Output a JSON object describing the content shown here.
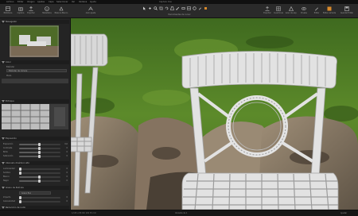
{
  "app": {
    "title": "Capture One",
    "menu": [
      "Archivo",
      "Editar",
      "Imagen",
      "Ajustes",
      "Capa",
      "Seleccionar",
      "Ver",
      "Ventana",
      "Ayuda"
    ]
  },
  "toolbar": {
    "left_buttons": [
      {
        "label": "Biblioteca",
        "icon": "library-icon"
      },
      {
        "label": "Captura",
        "icon": "capture-icon"
      },
      {
        "label": "Exportar",
        "icon": "export-icon"
      },
      {
        "label": "Metadatos",
        "icon": "metadata-icon"
      },
      {
        "label": "Balance Blanco",
        "icon": "white-balance-icon"
      },
      {
        "label": "Auto ajuste",
        "icon": "auto-adjust-icon"
      }
    ],
    "cursor_tools_label": "Herramientas de cursor",
    "right_buttons": [
      {
        "label": "Exportar",
        "icon": "export-icon"
      },
      {
        "label": "Cuadrícula",
        "icon": "grid-icon"
      },
      {
        "label": "Aviso de exp.",
        "icon": "exposure-warning-icon"
      },
      {
        "label": "Prueba",
        "icon": "proof-icon"
      },
      {
        "label": "Editar",
        "icon": "edit-icon"
      },
      {
        "label": "Editar variante",
        "icon": "edit-variant-icon"
      },
      {
        "label": "Guardar Editar",
        "icon": "save-edit-icon"
      }
    ]
  },
  "panel": {
    "navigator_title": "Navegador",
    "color_section_title": "Color",
    "preset_label": "Estándar",
    "color_dropdown": "Estándar de cámara",
    "mode_row": "Modo",
    "focus_title": "Enfoque",
    "exposure_title": "Exposición",
    "exposure_rows": [
      {
        "label": "Exposición",
        "value": "0,0"
      },
      {
        "label": "Contraste",
        "value": "0"
      },
      {
        "label": "Brillo",
        "value": "0"
      },
      {
        "label": "Saturación",
        "value": "0"
      }
    ],
    "hdr_title": "Intervalo dinámico alto",
    "hdr_rows": [
      {
        "label": "Luminosidad",
        "value": "0"
      },
      {
        "label": "Sombra",
        "value": "0"
      },
      {
        "label": "Blanco",
        "value": "0"
      },
      {
        "label": "Negro",
        "value": "0"
      }
    ],
    "film_title": "Grano de Película",
    "film_dropdown": "Grano fino",
    "film_rows": [
      {
        "label": "Impacto",
        "value": "0"
      },
      {
        "label": "Granularidad",
        "value": "0"
      }
    ],
    "noise_title": "Reducción de ruido"
  },
  "viewer": {
    "title": "IMG_4502.CR2"
  },
  "status": {
    "info": "1/125 s  f/8  ISO 100  35 mm",
    "center": "Variante de 1",
    "zoom": "Ajustar"
  },
  "colors": {
    "background": "#1b1b1b",
    "panel": "#242424",
    "accent_orange": "#d98a2b"
  }
}
